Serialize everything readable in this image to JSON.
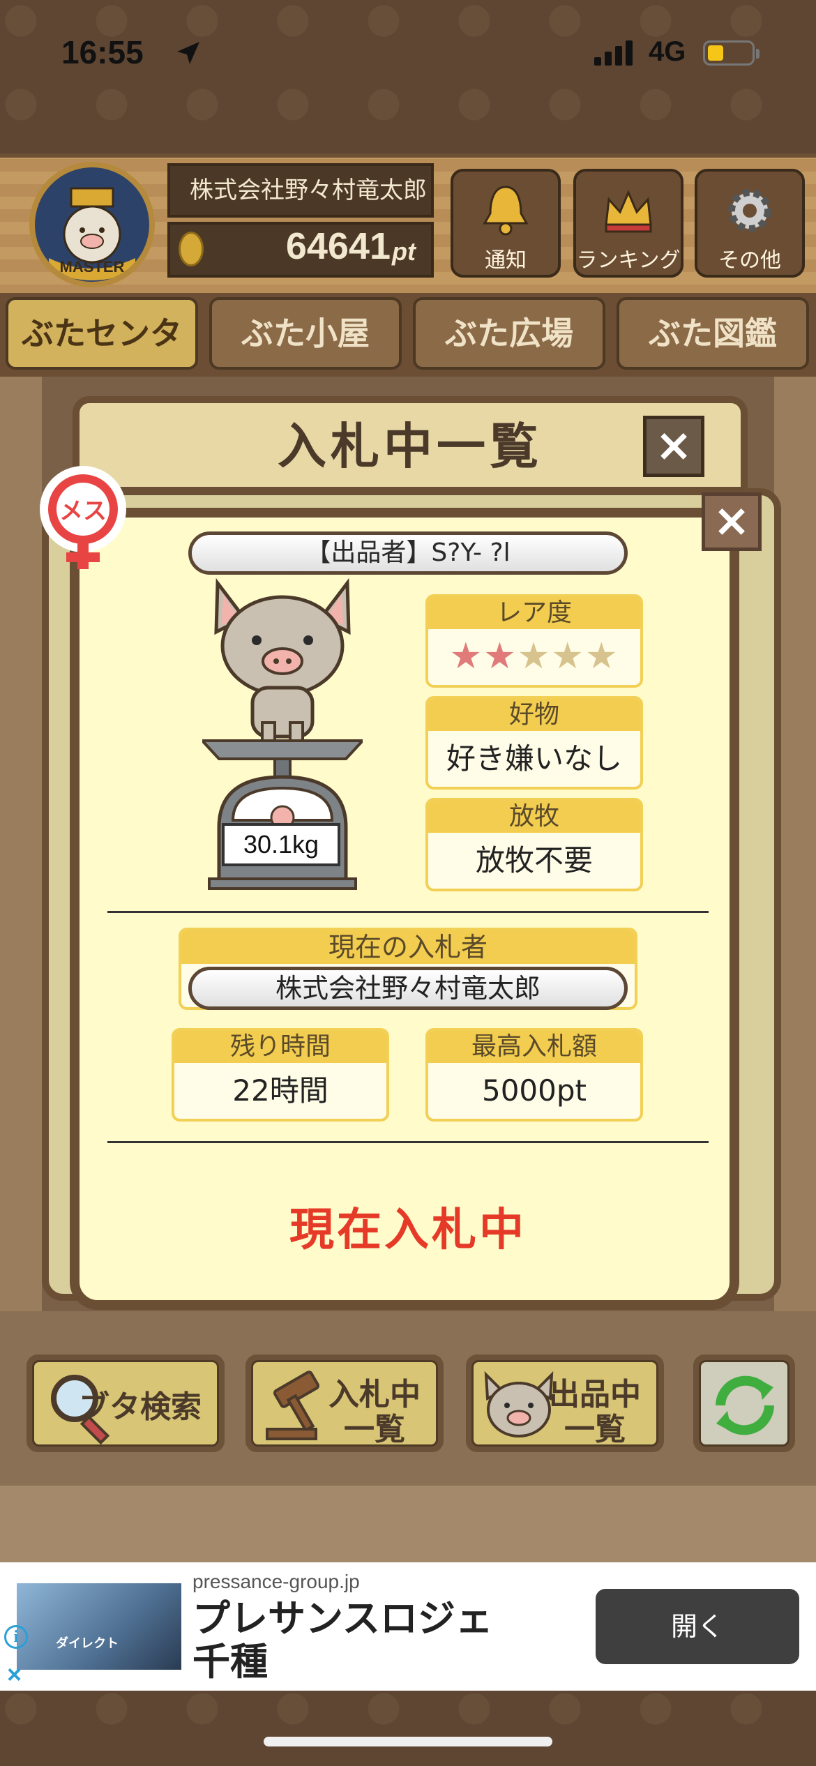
{
  "status_bar": {
    "time": "16:55",
    "network": "4G"
  },
  "header": {
    "avatar_label": "MASTER",
    "user_name": "株式会社野々村竜太郎",
    "points_value": "64641",
    "points_unit": "pt",
    "buttons": [
      {
        "label": "通知",
        "icon": "bell-icon"
      },
      {
        "label": "ランキング",
        "icon": "crown-icon"
      },
      {
        "label": "その他",
        "icon": "gear-icon"
      }
    ]
  },
  "tabs": [
    {
      "label": "ぶたセンター",
      "active": true
    },
    {
      "label": "ぶた小屋",
      "active": false
    },
    {
      "label": "ぶた広場",
      "active": false
    },
    {
      "label": "ぶた図鑑",
      "active": false
    }
  ],
  "modal": {
    "title": "入札中一覧",
    "close_back": "×",
    "close_front": "×",
    "gender_badge": "メス",
    "seller": "【出品者】S?Y- ?l",
    "weight": "30.1kg",
    "rarity": {
      "label": "レア度",
      "stars_filled": 2,
      "stars_total": 5
    },
    "favorite": {
      "label": "好物",
      "value": "好き嫌いなし"
    },
    "grazing": {
      "label": "放牧",
      "value": "放牧不要"
    },
    "current_bidder": {
      "label": "現在の入札者",
      "value": "株式会社野々村竜太郎"
    },
    "remaining_time": {
      "label": "残り時間",
      "value": "22時間"
    },
    "max_bid": {
      "label": "最高入札額",
      "value": "5000pt"
    },
    "status": "現在入札中"
  },
  "bottom_buttons": [
    {
      "label_line1": "ブタ検索",
      "label_line2": "",
      "icon": "magnifier-icon"
    },
    {
      "label_line1": "入札中",
      "label_line2": "一覧",
      "icon": "gavel-icon"
    },
    {
      "label_line1": "出品中",
      "label_line2": "一覧",
      "icon": "pig-face-icon"
    }
  ],
  "ad": {
    "domain": "pressance-group.jp",
    "title": "プレサンスロジェ千種",
    "image_caption": "ダイレクト",
    "button": "開く"
  },
  "colors": {
    "accent_yellow": "#f3cd4f",
    "status_red": "#e53a27",
    "wood_dark": "#6b4f35",
    "cream": "#fffbcb"
  }
}
